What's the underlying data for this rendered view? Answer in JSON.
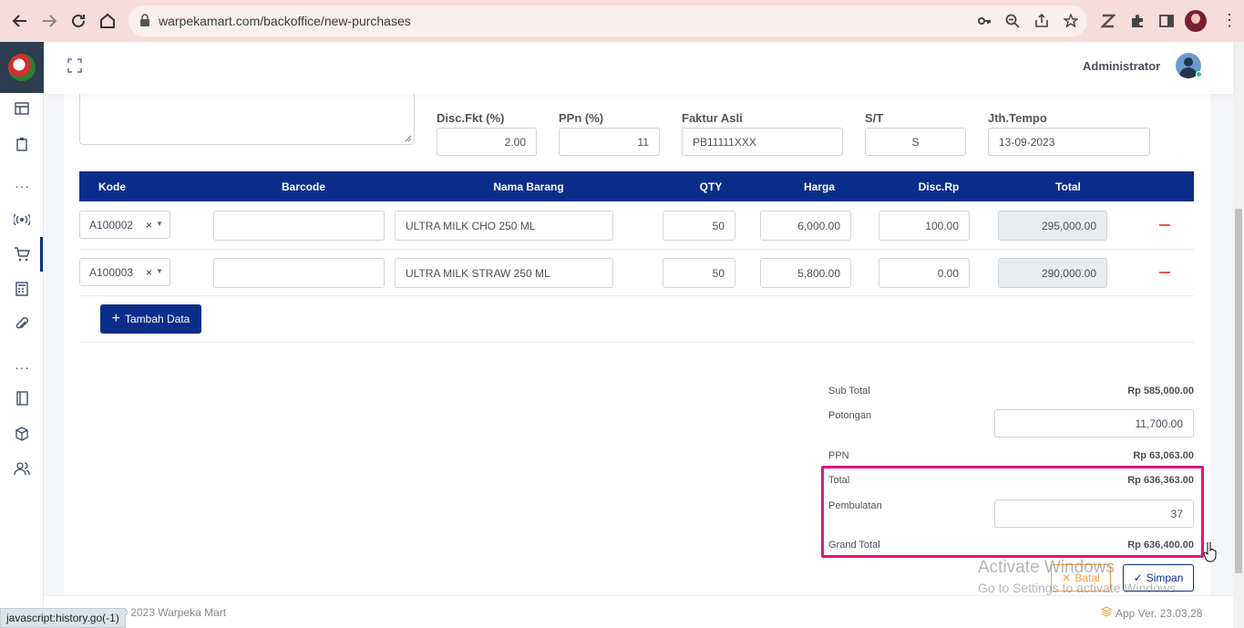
{
  "browser": {
    "url": "warpekamart.com/backoffice/new-purchases",
    "status_text": "javascript:history.go(-1)"
  },
  "header": {
    "user_name": "Administrator"
  },
  "form": {
    "disc_fkt": {
      "label": "Disc.Fkt (%)",
      "value": "2.00"
    },
    "ppn": {
      "label": "PPn (%)",
      "value": "11"
    },
    "faktur_asli": {
      "label": "Faktur Asli",
      "value": "PB11111XXX"
    },
    "st": {
      "label": "S/T",
      "value": "S"
    },
    "jth_tempo": {
      "label": "Jth.Tempo",
      "value": "13-09-2023"
    }
  },
  "table": {
    "columns": [
      "Kode",
      "Barcode",
      "Nama Barang",
      "QTY",
      "Harga",
      "Disc.Rp",
      "Total"
    ],
    "rows": [
      {
        "kode": "A100002",
        "barcode": "",
        "nama": "ULTRA MILK CHO 250 ML",
        "qty": "50",
        "harga": "6,000.00",
        "disc": "100.00",
        "total": "295,000.00"
      },
      {
        "kode": "A100003",
        "barcode": "",
        "nama": "ULTRA MILK STRAW 250 ML",
        "qty": "50",
        "harga": "5,800.00",
        "disc": "0.00",
        "total": "290,000.00"
      }
    ],
    "add_button": "Tambah Data"
  },
  "summary": {
    "sub_total_label": "Sub Total",
    "sub_total": "Rp 585,000.00",
    "potongan_label": "Potongan",
    "potongan": "11,700.00",
    "ppn_label": "PPN",
    "ppn": "Rp 63,063.00",
    "total_label": "Total",
    "total": "Rp 636,363.00",
    "pembulatan_label": "Pembulatan",
    "pembulatan": "37",
    "grand_total_label": "Grand Total",
    "grand_total": "Rp 636,400.00"
  },
  "actions": {
    "cancel": "Batal",
    "save": "Simpan"
  },
  "watermark": {
    "title": "Activate Windows",
    "subtitle": "Go to Settings to activate Windows."
  },
  "footer": {
    "copyright": "© 2023 Warpeka Mart",
    "version": "App Ver. 23.03.28"
  },
  "colors": {
    "primary": "#0b2d8a",
    "highlight": "#e8117f",
    "danger": "#ea5455",
    "warning": "#ff9f43"
  }
}
